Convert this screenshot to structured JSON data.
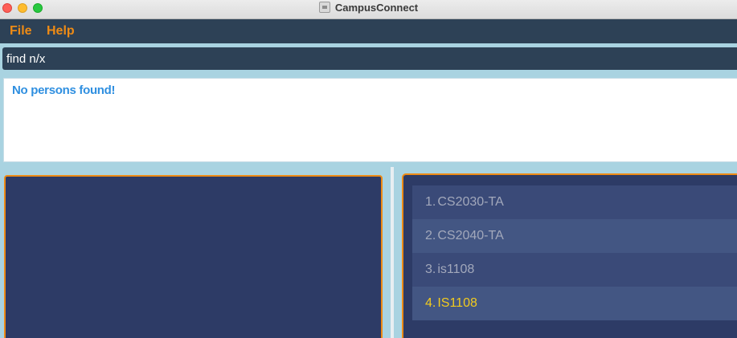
{
  "window": {
    "title": "CampusConnect"
  },
  "menu": {
    "items": [
      {
        "label": "File"
      },
      {
        "label": "Help"
      }
    ]
  },
  "command": {
    "value": "find n/x"
  },
  "result": {
    "message": "No persons found!"
  },
  "tags": {
    "items": [
      {
        "index": "1.",
        "label": "CS2030-TA",
        "selected": false
      },
      {
        "index": "2.",
        "label": "CS2040-TA",
        "selected": false
      },
      {
        "index": "3.",
        "label": "is1108",
        "selected": false
      },
      {
        "index": "4.",
        "label": "IS1108",
        "selected": true
      }
    ]
  },
  "colors": {
    "accent": "#ee8b15",
    "panel": "#2d3b66",
    "selected_text": "#f2cb1e",
    "result_text": "#2f8fe0"
  }
}
